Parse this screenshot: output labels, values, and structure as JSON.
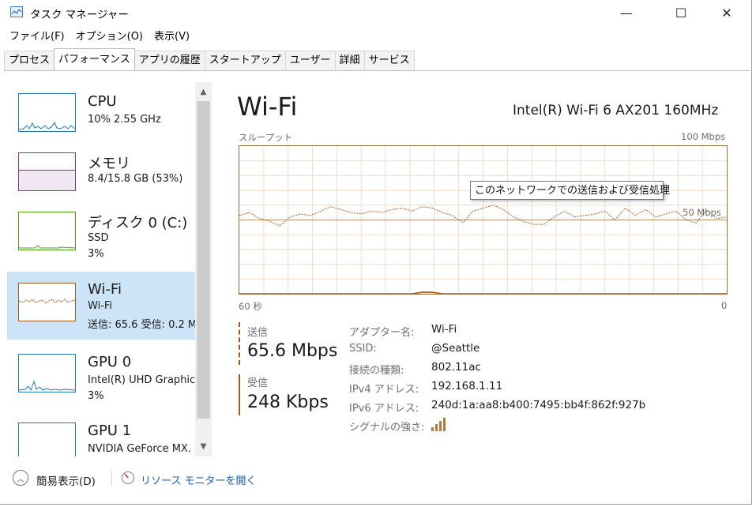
{
  "window": {
    "title": "タスク マネージャー",
    "minimize_glyph": "—",
    "maximize_glyph": "☐",
    "close_glyph": "✕"
  },
  "menu": [
    "ファイル(F)",
    "オプション(O)",
    "表示(V)"
  ],
  "tabs": [
    "プロセス",
    "パフォーマンス",
    "アプリの履歴",
    "スタートアップ",
    "ユーザー",
    "詳細",
    "サービス"
  ],
  "active_tab": "パフォーマンス",
  "sidebar": {
    "items": [
      {
        "title": "CPU",
        "line1": "10%  2.55 GHz",
        "line2": "",
        "color": "#1f78b4"
      },
      {
        "title": "メモリ",
        "line1": "8.4/15.8 GB (53%)",
        "line2": "",
        "color": "#8b2f9b"
      },
      {
        "title": "ディスク 0 (C:)",
        "line1": "SSD",
        "line2": "3%",
        "color": "#4da016"
      },
      {
        "title": "Wi-Fi",
        "line1": "Wi-Fi",
        "line2": "送信: 65.6  受信: 0.2 M",
        "color": "#a7591b"
      },
      {
        "title": "GPU 0",
        "line1": "Intel(R) UHD Graphic",
        "line2": "3%",
        "color": "#1f78b4"
      },
      {
        "title": "GPU 1",
        "line1": "NVIDIA GeForce MX.",
        "line2": "",
        "color": "#1f78b4"
      }
    ],
    "selected_index": 3
  },
  "detail": {
    "title": "Wi-Fi",
    "adapter_name": "Intel(R) Wi-Fi 6 AX201 160MHz",
    "graph_label": "スループット",
    "graph_max": "100 Mbps",
    "graph_mid": "50 Mbps",
    "time_left": "60 秒",
    "time_right": "0",
    "tooltip": "このネットワークでの送信および受信処理",
    "send_label": "送信",
    "send_value": "65.6 Mbps",
    "recv_label": "受信",
    "recv_value": "248 Kbps",
    "properties": [
      {
        "label": "アダプター名:",
        "value": "Wi-Fi"
      },
      {
        "label": "SSID:",
        "value": "@Seattle"
      },
      {
        "label": "接続の種類:",
        "value": "802.11ac"
      },
      {
        "label": "IPv4 アドレス:",
        "value": "192.168.1.11"
      },
      {
        "label": "IPv6 アドレス:",
        "value": "240d:1a:aa8:b400:7495:bb4f:862f:927b"
      },
      {
        "label": "シグナルの強さ:",
        "value": ""
      }
    ],
    "signal_bars": 4,
    "line_color": "#a7591b",
    "grid_color": "#f0dcc8"
  },
  "chart_data": {
    "type": "line",
    "xlabel": "",
    "ylabel": "",
    "x_range_label": [
      "60 秒",
      "0"
    ],
    "ylim": [
      0,
      100
    ],
    "series": [
      {
        "name": "送信",
        "values": [
          53,
          55,
          51,
          49,
          46,
          52,
          54,
          53,
          56,
          59,
          57,
          55,
          54,
          56,
          55,
          57,
          58,
          56,
          59,
          58,
          55,
          53,
          48,
          56,
          58,
          60,
          57,
          52,
          49,
          47,
          47,
          52,
          56,
          52,
          53,
          54,
          56,
          50,
          58,
          53,
          57,
          52,
          54,
          56,
          50,
          48,
          57,
          51,
          52
        ]
      },
      {
        "name": "受信",
        "values": [
          0,
          0,
          0,
          0,
          0,
          0,
          0,
          0,
          0,
          0,
          0,
          0,
          0,
          0,
          0,
          0,
          0,
          0,
          1,
          1,
          0,
          0,
          0,
          0,
          0,
          0,
          0,
          0,
          0,
          0,
          0,
          0,
          0,
          0,
          0,
          0,
          0,
          0,
          0,
          0,
          0,
          0,
          0,
          0,
          0,
          0,
          0,
          0,
          0
        ]
      }
    ]
  },
  "footer": {
    "collapse_label": "簡易表示(D)",
    "resource_monitor_label": "リソース モニターを開く"
  }
}
